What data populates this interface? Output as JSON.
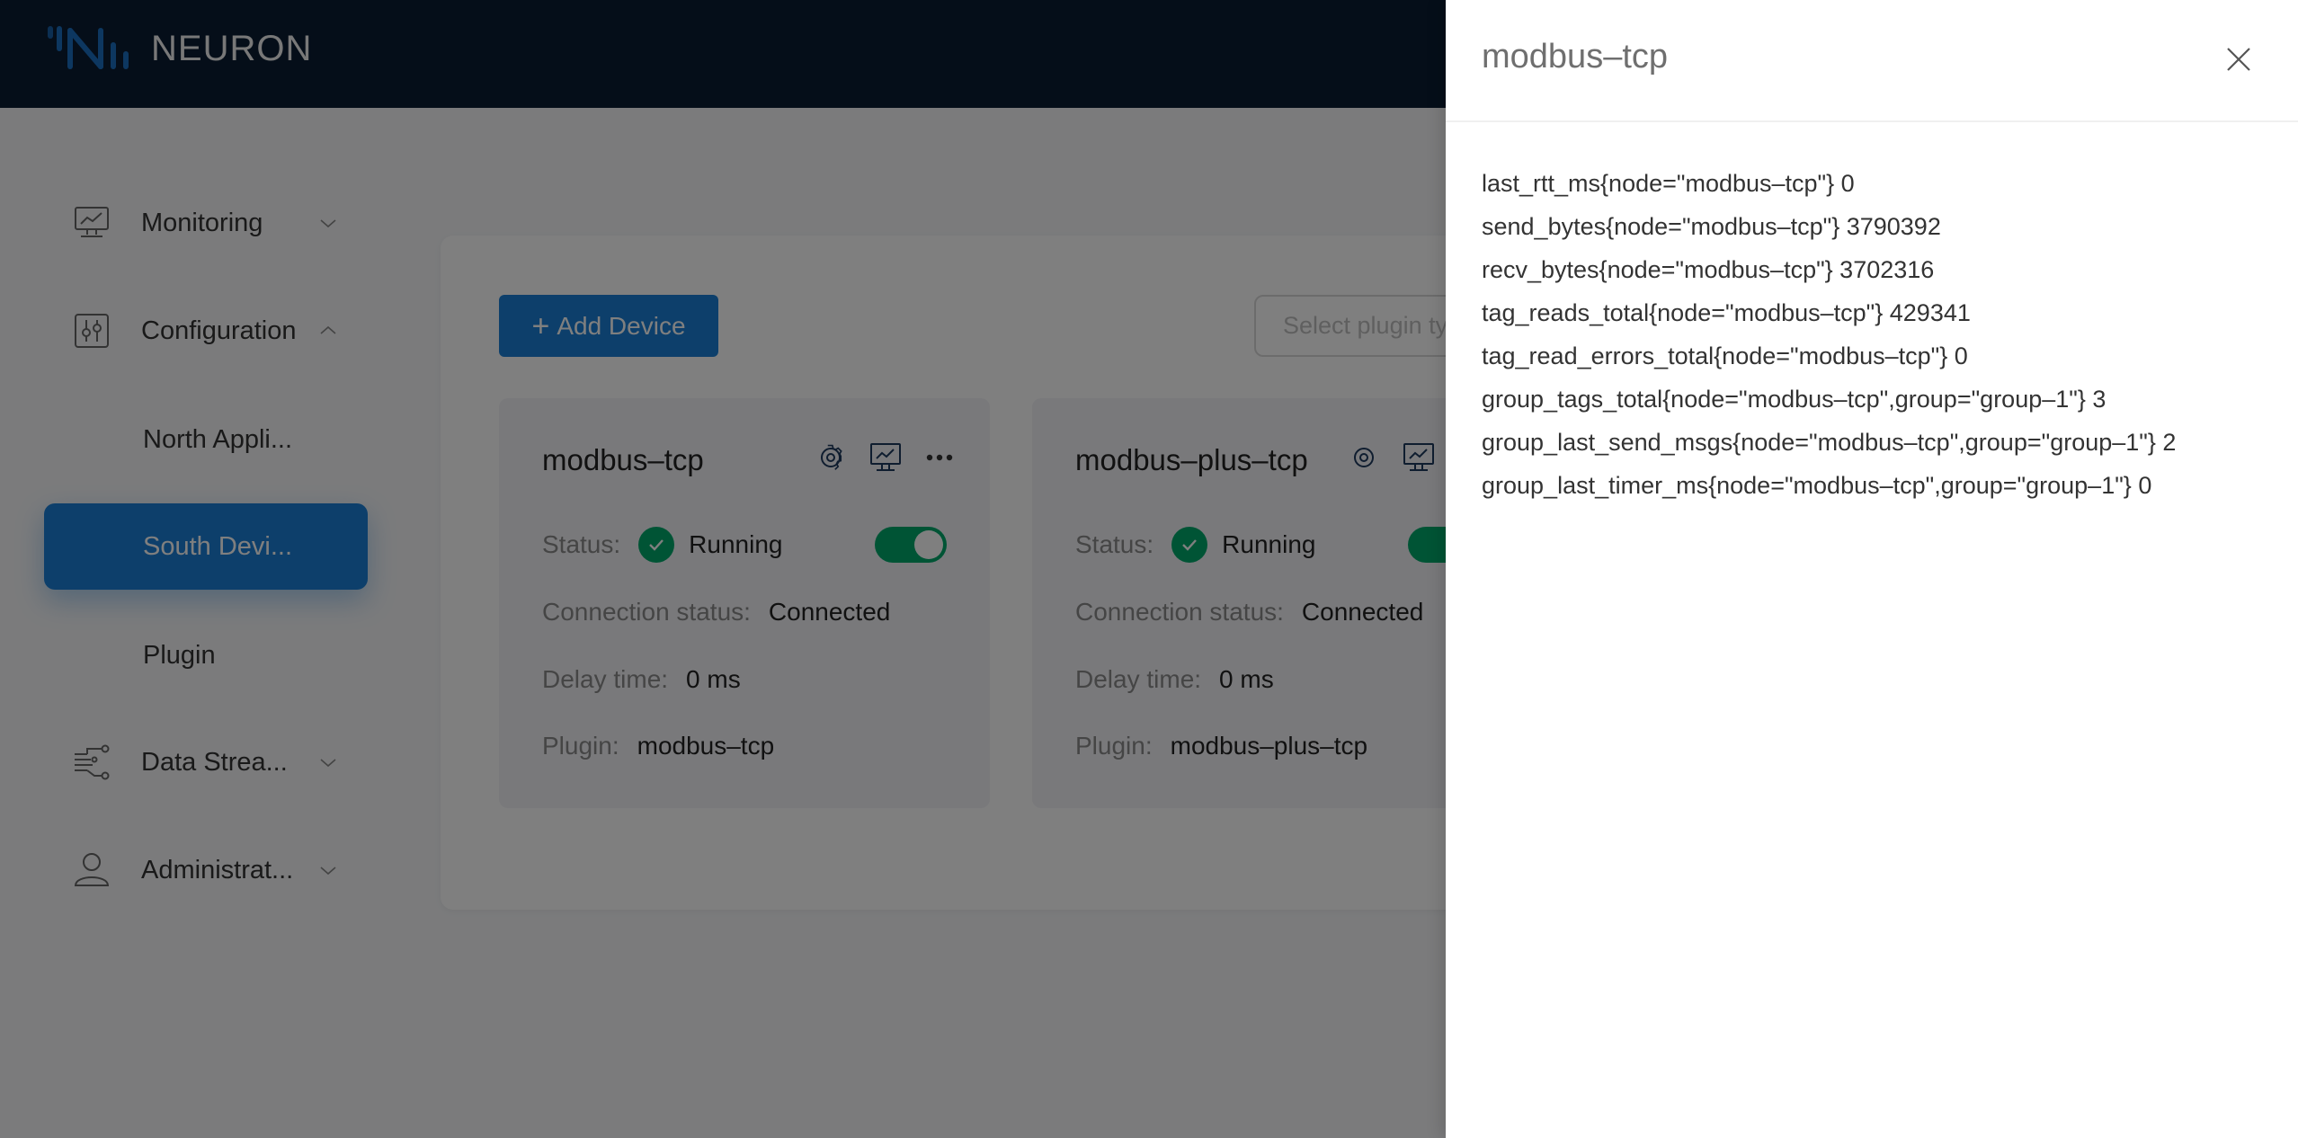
{
  "app": {
    "name": "NEURON"
  },
  "sidebar": {
    "items": [
      {
        "label": "Monitoring",
        "icon": "monitor-chart-icon",
        "expanded": false
      },
      {
        "label": "Configuration",
        "icon": "sliders-icon",
        "expanded": true,
        "children": [
          {
            "label": "North Appli..."
          },
          {
            "label": "South Devi...",
            "active": true
          },
          {
            "label": "Plugin"
          }
        ]
      },
      {
        "label": "Data Strea...",
        "icon": "data-stream-icon",
        "expanded": false
      },
      {
        "label": "Administrat...",
        "icon": "user-icon",
        "expanded": false
      }
    ]
  },
  "toolbar": {
    "add_device_label": "Add Device",
    "plugin_select_placeholder": "Select plugin type"
  },
  "devices": [
    {
      "name": "modbus–tcp",
      "status_label": "Status:",
      "status": "Running",
      "enabled": true,
      "connection_label": "Connection status:",
      "connection": "Connected",
      "delay_label": "Delay time:",
      "delay": "0 ms",
      "plugin_label": "Plugin:",
      "plugin": "modbus–tcp"
    },
    {
      "name": "modbus–plus–tcp",
      "status_label": "Status:",
      "status": "Running",
      "enabled": true,
      "connection_label": "Connection status:",
      "connection": "Connected",
      "delay_label": "Delay time:",
      "delay": "0 ms",
      "plugin_label": "Plugin:",
      "plugin": "modbus–plus–tcp"
    }
  ],
  "drawer": {
    "title": "modbus–tcp",
    "metrics": [
      "last_rtt_ms{node=\"modbus–tcp\"} 0",
      "send_bytes{node=\"modbus–tcp\"} 3790392",
      "recv_bytes{node=\"modbus–tcp\"} 3702316",
      "tag_reads_total{node=\"modbus–tcp\"} 429341",
      "tag_read_errors_total{node=\"modbus–tcp\"} 0",
      "group_tags_total{node=\"modbus–tcp\",group=\"group–1\"} 3",
      "group_last_send_msgs{node=\"modbus–tcp\",group=\"group–1\"} 2",
      "group_last_timer_ms{node=\"modbus–tcp\",group=\"group–1\"} 0"
    ]
  },
  "colors": {
    "header_bg": "#0b1d33",
    "primary": "#1a7fd6",
    "success": "#00a86b"
  }
}
